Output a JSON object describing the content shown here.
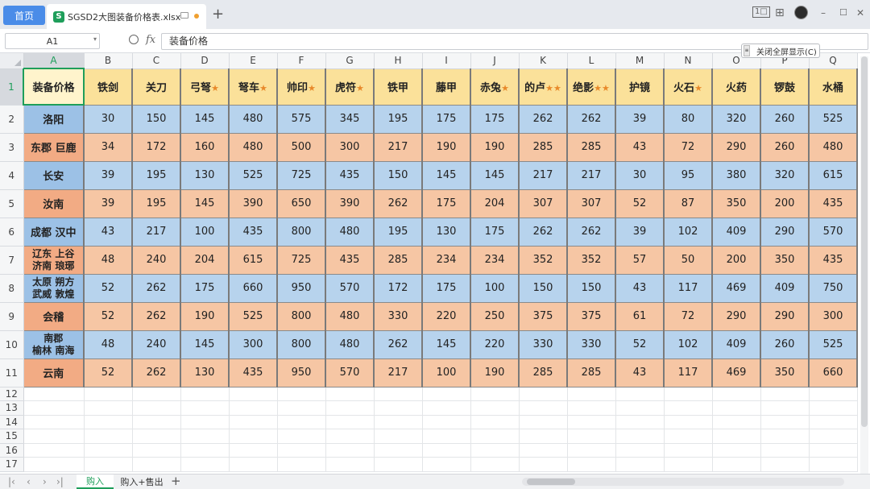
{
  "titlebar": {
    "home_label": "首页",
    "file_icon": "S",
    "file_name": "SGSD2大图装备价格表.xlsx",
    "new_tab": "+",
    "controls": {
      "minimize": "–",
      "maximize": "☐",
      "close": "✕",
      "layout_icon": "1□",
      "grid_icon": "⊞"
    }
  },
  "formulabar": {
    "name_box": "A1",
    "name_box_caret": "▾",
    "fx_label": "fx",
    "formula_value": "装备价格",
    "fullscreen_btn": "关闭全屏显示(C)",
    "fullscreen_handle": "≡"
  },
  "columns": [
    "A",
    "B",
    "C",
    "D",
    "E",
    "F",
    "G",
    "H",
    "I",
    "J",
    "K",
    "L",
    "M",
    "N",
    "O",
    "P",
    "Q"
  ],
  "header_row": {
    "corner": "装备价格",
    "items": [
      {
        "name": "铁剑",
        "stars": ""
      },
      {
        "name": "关刀",
        "stars": ""
      },
      {
        "name": "弓弩",
        "stars": "★"
      },
      {
        "name": "弩车",
        "stars": "★"
      },
      {
        "name": "帅印",
        "stars": "★"
      },
      {
        "name": "虎符",
        "stars": "★"
      },
      {
        "name": "铁甲",
        "stars": ""
      },
      {
        "name": "藤甲",
        "stars": ""
      },
      {
        "name": "赤兔",
        "stars": "★"
      },
      {
        "name": "的卢",
        "stars": "★★"
      },
      {
        "name": "绝影",
        "stars": "★★"
      },
      {
        "name": "护镜",
        "stars": ""
      },
      {
        "name": "火石",
        "stars": "★"
      },
      {
        "name": "火药",
        "stars": ""
      },
      {
        "name": "锣鼓",
        "stars": ""
      },
      {
        "name": "水桶",
        "stars": ""
      }
    ]
  },
  "rows": [
    {
      "num": "2",
      "city": [
        "洛阳"
      ],
      "values": [
        "30",
        "150",
        "145",
        "480",
        "575",
        "345",
        "195",
        "175",
        "175",
        "262",
        "262",
        "39",
        "80",
        "320",
        "260",
        "525"
      ]
    },
    {
      "num": "3",
      "city": [
        "东郡 巨鹿"
      ],
      "values": [
        "34",
        "172",
        "160",
        "480",
        "500",
        "300",
        "217",
        "190",
        "190",
        "285",
        "285",
        "43",
        "72",
        "290",
        "260",
        "480"
      ]
    },
    {
      "num": "4",
      "city": [
        "长安"
      ],
      "values": [
        "39",
        "195",
        "130",
        "525",
        "725",
        "435",
        "150",
        "145",
        "145",
        "217",
        "217",
        "30",
        "95",
        "380",
        "320",
        "615"
      ]
    },
    {
      "num": "5",
      "city": [
        "汝南"
      ],
      "values": [
        "39",
        "195",
        "145",
        "390",
        "650",
        "390",
        "262",
        "175",
        "204",
        "307",
        "307",
        "52",
        "87",
        "350",
        "200",
        "435"
      ]
    },
    {
      "num": "6",
      "city": [
        "成都 汉中"
      ],
      "values": [
        "43",
        "217",
        "100",
        "435",
        "800",
        "480",
        "195",
        "130",
        "175",
        "262",
        "262",
        "39",
        "102",
        "409",
        "290",
        "570"
      ]
    },
    {
      "num": "7",
      "city": [
        "辽东 上谷",
        "济南 琅琊"
      ],
      "values": [
        "48",
        "240",
        "204",
        "615",
        "725",
        "435",
        "285",
        "234",
        "234",
        "352",
        "352",
        "57",
        "50",
        "200",
        "350",
        "435"
      ]
    },
    {
      "num": "8",
      "city": [
        "太原 朔方",
        "武威 敦煌"
      ],
      "values": [
        "52",
        "262",
        "175",
        "660",
        "950",
        "570",
        "172",
        "175",
        "100",
        "150",
        "150",
        "43",
        "117",
        "469",
        "409",
        "750"
      ]
    },
    {
      "num": "9",
      "city": [
        "会稽"
      ],
      "values": [
        "52",
        "262",
        "190",
        "525",
        "800",
        "480",
        "330",
        "220",
        "250",
        "375",
        "375",
        "61",
        "72",
        "290",
        "290",
        "300"
      ]
    },
    {
      "num": "10",
      "city": [
        "南郡",
        "榆林 南海"
      ],
      "values": [
        "48",
        "240",
        "145",
        "300",
        "800",
        "480",
        "262",
        "145",
        "220",
        "330",
        "330",
        "52",
        "102",
        "409",
        "260",
        "525"
      ]
    },
    {
      "num": "11",
      "city": [
        "云南"
      ],
      "values": [
        "52",
        "262",
        "130",
        "435",
        "950",
        "570",
        "217",
        "100",
        "190",
        "285",
        "285",
        "43",
        "117",
        "469",
        "350",
        "660"
      ]
    }
  ],
  "empty_rows": [
    "12",
    "13",
    "14",
    "15",
    "16",
    "17"
  ],
  "sheets": {
    "active": "购入",
    "other": "购入+售出",
    "add": "+"
  },
  "colors": {
    "header_fill": "#fbe19a",
    "blue_fill": "#b7d3ed",
    "orange_fill": "#f6c6a4",
    "star": "#e8892a",
    "accent": "#1e9e5a",
    "home_tab": "#4a8ce8"
  }
}
